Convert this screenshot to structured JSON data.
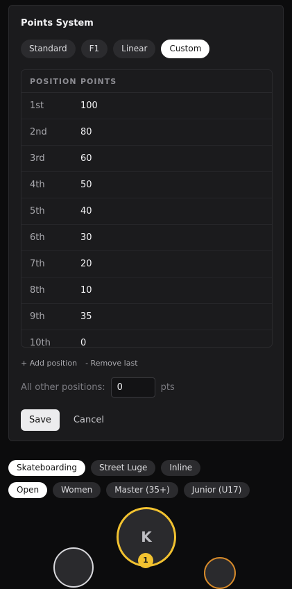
{
  "points_system": {
    "title": "Points System",
    "presets": [
      "Standard",
      "F1",
      "Linear",
      "Custom"
    ],
    "active_preset": "Custom",
    "table": {
      "headers": {
        "position": "POSITION",
        "points": "POINTS"
      },
      "rows": [
        {
          "position": "1st",
          "points": "100"
        },
        {
          "position": "2nd",
          "points": "80"
        },
        {
          "position": "3rd",
          "points": "60"
        },
        {
          "position": "4th",
          "points": "50"
        },
        {
          "position": "5th",
          "points": "40"
        },
        {
          "position": "6th",
          "points": "30"
        },
        {
          "position": "7th",
          "points": "20"
        },
        {
          "position": "8th",
          "points": "10"
        },
        {
          "position": "9th",
          "points": "35"
        },
        {
          "position": "10th",
          "points": "0"
        }
      ]
    },
    "add_position_label": "+ Add position",
    "remove_last_label": "- Remove last",
    "other_positions": {
      "label": "All other positions:",
      "value": "0",
      "unit": "pts"
    },
    "save_label": "Save",
    "cancel_label": "Cancel"
  },
  "disciplines": {
    "items": [
      "Skateboarding",
      "Street Luge",
      "Inline"
    ],
    "active": "Skateboarding"
  },
  "categories": {
    "items": [
      "Open",
      "Women",
      "Master (35+)",
      "Junior (U17)"
    ],
    "active": "Open"
  },
  "podium": {
    "first_initial": "K",
    "first_rank": "1"
  },
  "colors": {
    "gold": "#f2c230",
    "silver": "#d8d8dc",
    "bronze": "#d68a2a",
    "panel": "#1b1b1d"
  }
}
